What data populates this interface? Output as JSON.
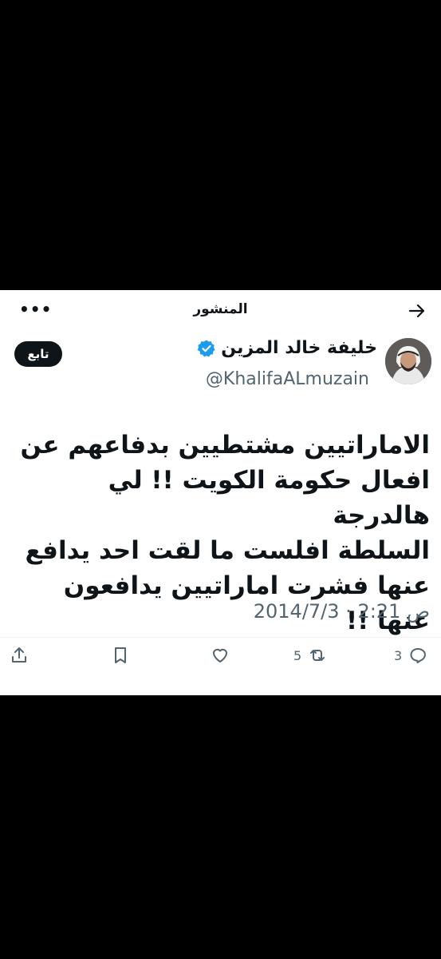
{
  "header": {
    "title": "المنشور",
    "back_icon": "arrow-right-icon",
    "more_icon": "more-icon",
    "more_label": "•••"
  },
  "author": {
    "name": "خليفة خالد المزين",
    "handle": "@KhalifaALmuzain",
    "verified": true,
    "verified_color": "#1d9bf0"
  },
  "follow_label": "تابع",
  "tweet": {
    "lines": [
      "الاماراتيين مشتطيين بدفاعهم عن",
      "افعال حكومة الكويت !! لي هالدرجة",
      "السلطة افلست ما لقت احد يدافع",
      "عنها فشرت اماراتيين يدافعون عنها !!"
    ]
  },
  "meta": {
    "date": "2014/7/3",
    "separator": "·",
    "time": "2:21 ص"
  },
  "actions": {
    "reply_count": "3",
    "retweet_count": "5",
    "like_icon": "heart-icon",
    "bookmark_icon": "bookmark-icon",
    "share_icon": "share-icon"
  }
}
